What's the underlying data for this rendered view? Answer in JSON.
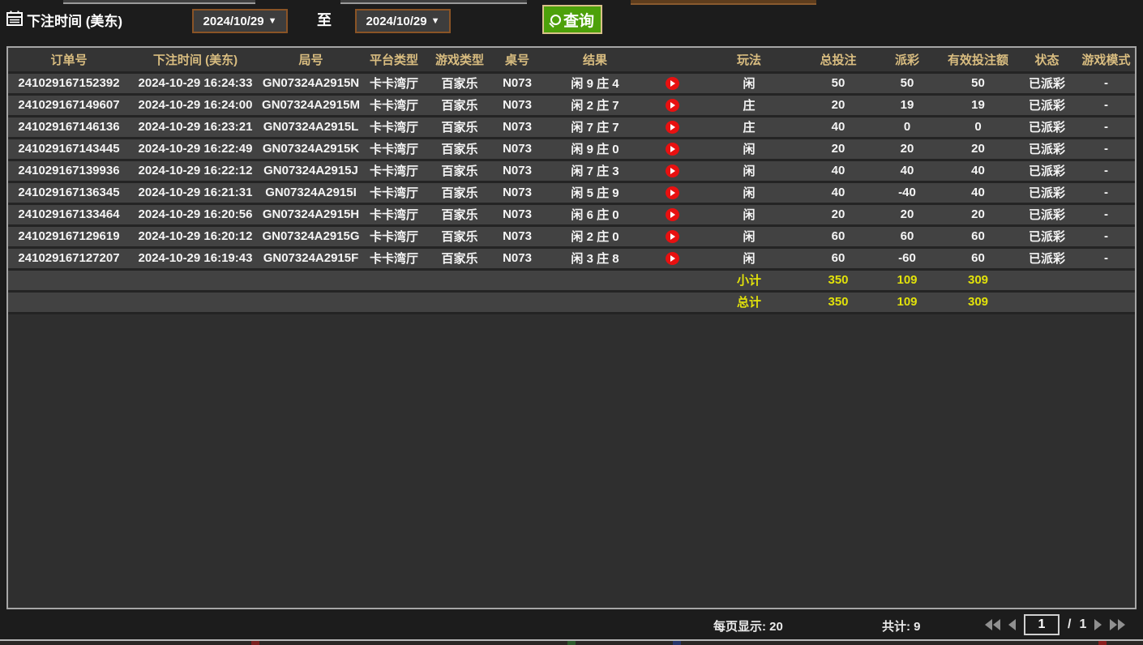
{
  "toolbar": {
    "label": "下注时间 (美东)",
    "date_from": "2024/10/29",
    "to_label": "至",
    "date_to": "2024/10/29",
    "arrow": "▼",
    "search_label": "查询"
  },
  "table": {
    "headers": [
      "订单号",
      "下注时间 (美东)",
      "局号",
      "平台类型",
      "游戏类型",
      "桌号",
      "结果",
      "玩法",
      "总投注",
      "派彩",
      "有效投注额",
      "状态",
      "游戏模式"
    ],
    "rows": [
      {
        "order_id": "241029167152392",
        "bet_time": "2024-10-29 16:24:33",
        "round_id": "GN07324A2915N",
        "platform": "卡卡湾厅",
        "game_type": "百家乐",
        "table_no": "N073",
        "result": "闲 9 庄 4",
        "play": "闲",
        "total_bet": "50",
        "payout": "50",
        "payout_color": "red",
        "valid_bet": "50",
        "status": "已派彩",
        "game_mode": "-"
      },
      {
        "order_id": "241029167149607",
        "bet_time": "2024-10-29 16:24:00",
        "round_id": "GN07324A2915M",
        "platform": "卡卡湾厅",
        "game_type": "百家乐",
        "table_no": "N073",
        "result": "闲 2 庄 7",
        "play": "庄",
        "total_bet": "20",
        "payout": "19",
        "payout_color": "red",
        "valid_bet": "19",
        "status": "已派彩",
        "game_mode": "-"
      },
      {
        "order_id": "241029167146136",
        "bet_time": "2024-10-29 16:23:21",
        "round_id": "GN07324A2915L",
        "platform": "卡卡湾厅",
        "game_type": "百家乐",
        "table_no": "N073",
        "result": "闲 7 庄 7",
        "play": "庄",
        "total_bet": "40",
        "payout": "0",
        "payout_color": "white",
        "valid_bet": "0",
        "status": "已派彩",
        "game_mode": "-"
      },
      {
        "order_id": "241029167143445",
        "bet_time": "2024-10-29 16:22:49",
        "round_id": "GN07324A2915K",
        "platform": "卡卡湾厅",
        "game_type": "百家乐",
        "table_no": "N073",
        "result": "闲 9 庄 0",
        "play": "闲",
        "total_bet": "20",
        "payout": "20",
        "payout_color": "red",
        "valid_bet": "20",
        "status": "已派彩",
        "game_mode": "-"
      },
      {
        "order_id": "241029167139936",
        "bet_time": "2024-10-29 16:22:12",
        "round_id": "GN07324A2915J",
        "platform": "卡卡湾厅",
        "game_type": "百家乐",
        "table_no": "N073",
        "result": "闲 7 庄 3",
        "play": "闲",
        "total_bet": "40",
        "payout": "40",
        "payout_color": "red",
        "valid_bet": "40",
        "status": "已派彩",
        "game_mode": "-"
      },
      {
        "order_id": "241029167136345",
        "bet_time": "2024-10-29 16:21:31",
        "round_id": "GN07324A2915I",
        "platform": "卡卡湾厅",
        "game_type": "百家乐",
        "table_no": "N073",
        "result": "闲 5 庄 9",
        "play": "闲",
        "total_bet": "40",
        "payout": "-40",
        "payout_color": "green",
        "valid_bet": "40",
        "status": "已派彩",
        "game_mode": "-"
      },
      {
        "order_id": "241029167133464",
        "bet_time": "2024-10-29 16:20:56",
        "round_id": "GN07324A2915H",
        "platform": "卡卡湾厅",
        "game_type": "百家乐",
        "table_no": "N073",
        "result": "闲 6 庄 0",
        "play": "闲",
        "total_bet": "20",
        "payout": "20",
        "payout_color": "red",
        "valid_bet": "20",
        "status": "已派彩",
        "game_mode": "-"
      },
      {
        "order_id": "241029167129619",
        "bet_time": "2024-10-29 16:20:12",
        "round_id": "GN07324A2915G",
        "platform": "卡卡湾厅",
        "game_type": "百家乐",
        "table_no": "N073",
        "result": "闲 2 庄 0",
        "play": "闲",
        "total_bet": "60",
        "payout": "60",
        "payout_color": "red",
        "valid_bet": "60",
        "status": "已派彩",
        "game_mode": "-"
      },
      {
        "order_id": "241029167127207",
        "bet_time": "2024-10-29 16:19:43",
        "round_id": "GN07324A2915F",
        "platform": "卡卡湾厅",
        "game_type": "百家乐",
        "table_no": "N073",
        "result": "闲 3 庄 8",
        "play": "闲",
        "total_bet": "60",
        "payout": "-60",
        "payout_color": "green",
        "valid_bet": "60",
        "status": "已派彩",
        "game_mode": "-"
      }
    ],
    "subtotal": {
      "label": "小计",
      "total_bet": "350",
      "payout": "109",
      "valid_bet": "309"
    },
    "total": {
      "label": "总计",
      "total_bet": "350",
      "payout": "109",
      "valid_bet": "309"
    }
  },
  "footer": {
    "per_page": "每页显示: 20",
    "total_count": "共计: 9",
    "page_current": "1",
    "page_separator": "/",
    "page_total": "1"
  },
  "colors": {
    "button_green": "#4da10a",
    "button_border": "#d9c189",
    "select_border": "#8a5426",
    "header_text": "#d9bd80",
    "payout_win_red": "#c01b1b",
    "payout_loss_green": "#4cd41c",
    "status_green": "#2fd32f",
    "totals_yellow": "#e2e20a",
    "play_icon_red": "#e81010"
  }
}
